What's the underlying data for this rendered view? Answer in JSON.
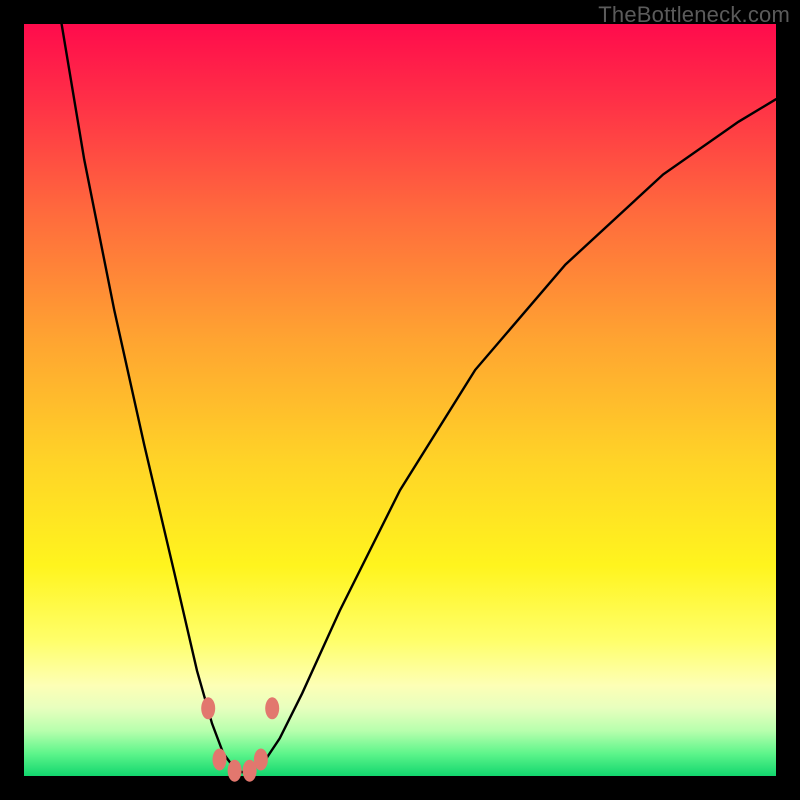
{
  "watermark": "TheBottleneck.com",
  "chart_data": {
    "type": "line",
    "title": "",
    "xlabel": "",
    "ylabel": "",
    "xlim": [
      0,
      100
    ],
    "ylim": [
      0,
      100
    ],
    "grid": false,
    "legend": false,
    "series": [
      {
        "name": "bottleneck-curve",
        "x": [
          5,
          8,
          12,
          16,
          20,
          23,
          25,
          26.5,
          28,
          29,
          30,
          32,
          34,
          37,
          42,
          50,
          60,
          72,
          85,
          95,
          100
        ],
        "y": [
          100,
          82,
          62,
          44,
          27,
          14,
          7,
          3,
          1,
          0.5,
          0.8,
          2,
          5,
          11,
          22,
          38,
          54,
          68,
          80,
          87,
          90
        ]
      }
    ],
    "markers": [
      {
        "x": 24.5,
        "y": 9
      },
      {
        "x": 26.0,
        "y": 2.2
      },
      {
        "x": 28.0,
        "y": 0.7
      },
      {
        "x": 30.0,
        "y": 0.7
      },
      {
        "x": 31.5,
        "y": 2.2
      },
      {
        "x": 33.0,
        "y": 9
      }
    ],
    "marker_style": {
      "color": "#e2776e",
      "rx": 7,
      "ry": 11
    }
  },
  "colors": {
    "frame_bg_top": "#ff0b4c",
    "frame_bg_bottom": "#12d66e",
    "curve": "#000000",
    "marker": "#e2776e",
    "page_bg": "#000000"
  }
}
